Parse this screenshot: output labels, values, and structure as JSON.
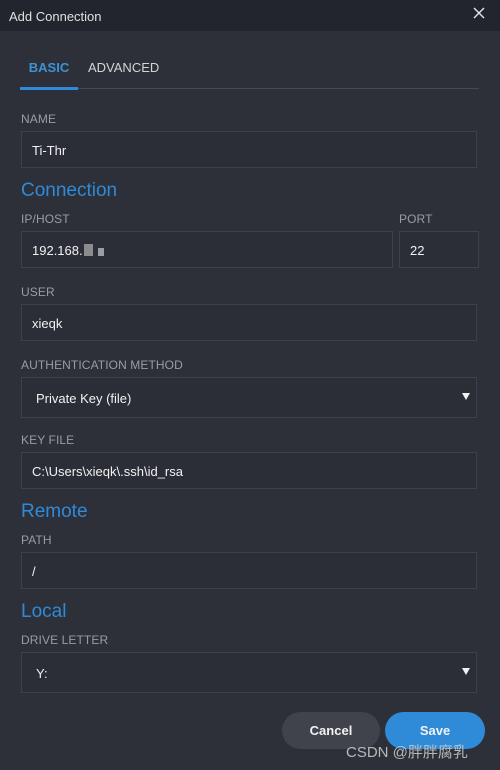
{
  "window": {
    "title": "Add Connection",
    "close_icon": "close-icon"
  },
  "tabs": [
    {
      "label": "BASIC",
      "active": true
    },
    {
      "label": "ADVANCED",
      "active": false
    }
  ],
  "form": {
    "name": {
      "label": "NAME",
      "value": "Ti-Thr"
    },
    "connection_heading": "Connection",
    "host": {
      "label": "IP/HOST",
      "value": "192.168."
    },
    "port": {
      "label": "PORT",
      "value": "22"
    },
    "user": {
      "label": "USER",
      "value": "xieqk"
    },
    "auth": {
      "label": "AUTHENTICATION METHOD",
      "value": "Private Key (file)"
    },
    "keyfile": {
      "label": "KEY FILE",
      "value": "C:\\Users\\xieqk\\.ssh\\id_rsa"
    },
    "remote_heading": "Remote",
    "path": {
      "label": "PATH",
      "value": "/"
    },
    "local_heading": "Local",
    "drive": {
      "label": "DRIVE LETTER",
      "value": "Y:"
    }
  },
  "buttons": {
    "cancel": "Cancel",
    "save": "Save"
  },
  "watermark": "CSDN @胖胖腐乳",
  "colors": {
    "accent": "#2f8ad8",
    "background": "#2d3038",
    "titlebar": "#22252d"
  }
}
